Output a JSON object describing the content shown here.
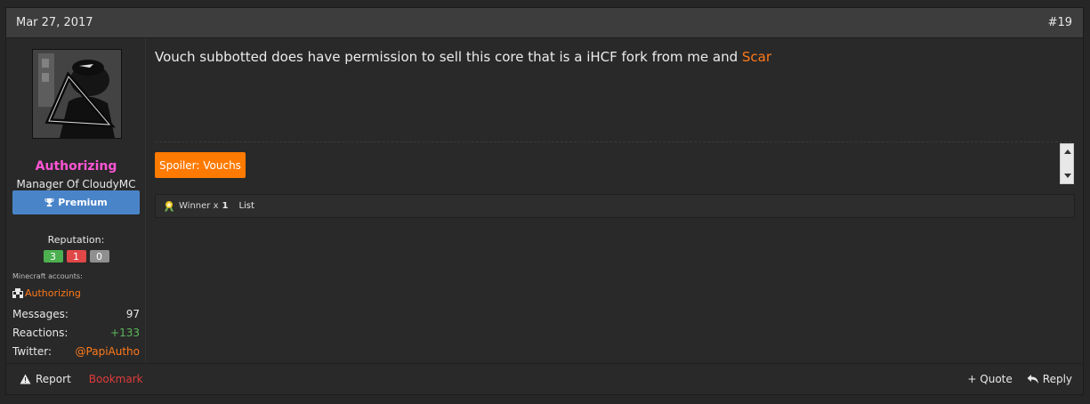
{
  "post": {
    "date": "Mar 27, 2017",
    "number": "#19"
  },
  "user": {
    "name": "Authorizing",
    "title": "Manager Of CloudyMC",
    "banner": "Premium",
    "reputation_label": "Reputation:",
    "reputation": {
      "positive": "3",
      "negative": "1",
      "neutral": "0"
    },
    "minecraft_label": "Minecraft accounts:",
    "minecraft_account": "Authorizing",
    "stats": [
      {
        "label": "Messages:",
        "value": "97"
      },
      {
        "label": "Reactions:",
        "value": "+133"
      },
      {
        "label": "Twitter:",
        "value": "@PapiAutho"
      }
    ]
  },
  "message": {
    "text": "Vouch subbotted does have permission to sell this core that is a iHCF fork from me and ",
    "mention": "Scar"
  },
  "signature": {
    "spoiler_label": "Spoiler: Vouchs"
  },
  "reactions": {
    "label": "Winner x",
    "count": "1",
    "list_label": "List"
  },
  "footer": {
    "report": "Report",
    "bookmark": "Bookmark",
    "quote": "+ Quote",
    "reply": "Reply"
  },
  "colors": {
    "username": "#ff55d4",
    "accent_orange": "#ff7a1a",
    "banner_blue": "#4a84c8",
    "bookmark_red": "#e03b3b"
  }
}
